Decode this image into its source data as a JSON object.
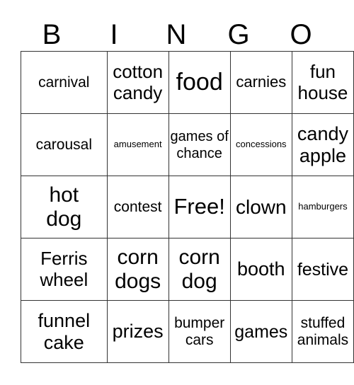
{
  "header": [
    "B",
    "I",
    "N",
    "G",
    "O"
  ],
  "cells": [
    [
      "carnival",
      "cotton candy",
      "food",
      "carnies",
      "fun house"
    ],
    [
      "carousal",
      "amusement",
      "games of chance",
      "concessions",
      "candy apple"
    ],
    [
      "hot dog",
      "contest",
      "Free!",
      "clown",
      "hamburgers"
    ],
    [
      "Ferris wheel",
      "corn dogs",
      "corn dog",
      "booth",
      "festive"
    ],
    [
      "funnel cake",
      "prizes",
      "bumper cars",
      "games",
      "stuffed animals"
    ]
  ]
}
